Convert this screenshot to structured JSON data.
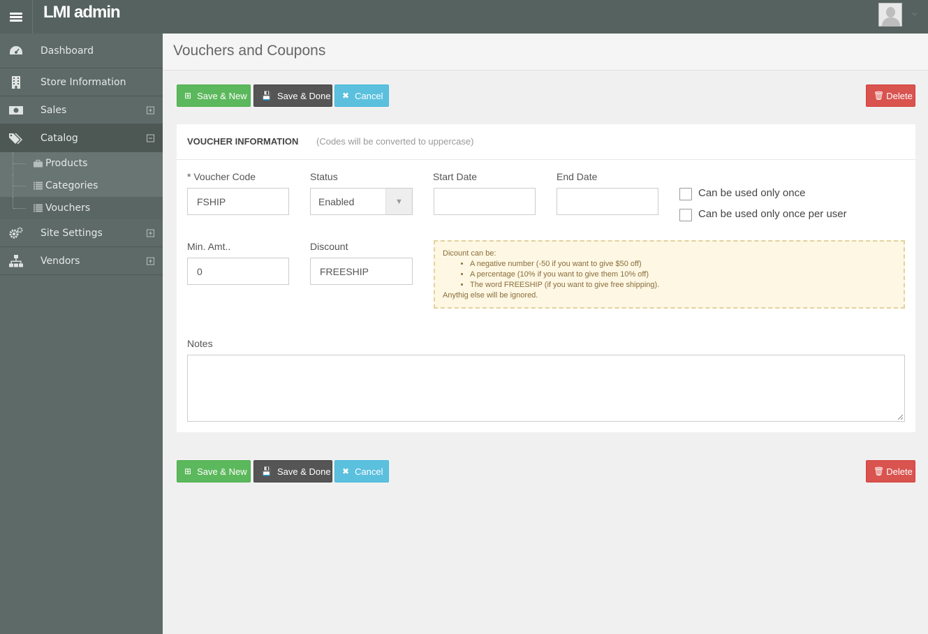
{
  "app": {
    "brand": "LMI admin"
  },
  "icons": {
    "menu": "hamburger-icon",
    "avatar": "user-avatar-icon",
    "dashboard": "dashboard-icon",
    "store": "building-icon",
    "sales": "money-icon",
    "catalog": "tags-icon",
    "products": "shopping-bag-icon",
    "list": "list-icon",
    "settings": "cogs-icon",
    "vendors": "sitemap-icon"
  },
  "sidebar": {
    "items": [
      {
        "label": "Dashboard"
      },
      {
        "label": "Store Information"
      },
      {
        "label": "Sales"
      },
      {
        "label": "Catalog"
      },
      {
        "label": "Site Settings"
      },
      {
        "label": "Vendors"
      }
    ],
    "catalog_sub": [
      {
        "label": "Products"
      },
      {
        "label": "Categories"
      },
      {
        "label": "Vouchers"
      }
    ]
  },
  "page": {
    "title": "Vouchers and Coupons"
  },
  "buttons": {
    "save_new": "Save & New",
    "save_done": "Save & Done",
    "cancel": "Cancel",
    "delete": "Delete"
  },
  "form": {
    "section_title": "VOUCHER INFORMATION",
    "section_hint": "(Codes will be converted to uppercase)",
    "voucher_code_label": "* Voucher Code",
    "voucher_code_value": "FSHIP",
    "status_label": "Status",
    "status_value": "Enabled",
    "start_date_label": "Start Date",
    "start_date_value": "",
    "end_date_label": "End Date",
    "end_date_value": "",
    "once_label": "Can be used only once",
    "once_per_user_label": "Can be used only once per user",
    "min_amt_label": "Min. Amt..",
    "min_amt_value": "0",
    "discount_label": "Discount",
    "discount_value": "FREESHIP",
    "notes_label": "Notes",
    "notes_value": ""
  },
  "hint": {
    "intro": "Dicount can be:",
    "items": [
      "A negative number (-50 if you want to give $50 off)",
      "A percentage (10% if you want to give them 10% off)",
      "The word FREESHIP (if you want to give free shipping)."
    ],
    "outro": "Anythig else will be ignored."
  },
  "colors": {
    "topbar": "#56625f",
    "sidebar": "#5d6a67",
    "success": "#5cb85c",
    "dark": "#555555",
    "info": "#5bc0de",
    "danger": "#d9534f",
    "hint_bg": "#fdf7e3"
  }
}
